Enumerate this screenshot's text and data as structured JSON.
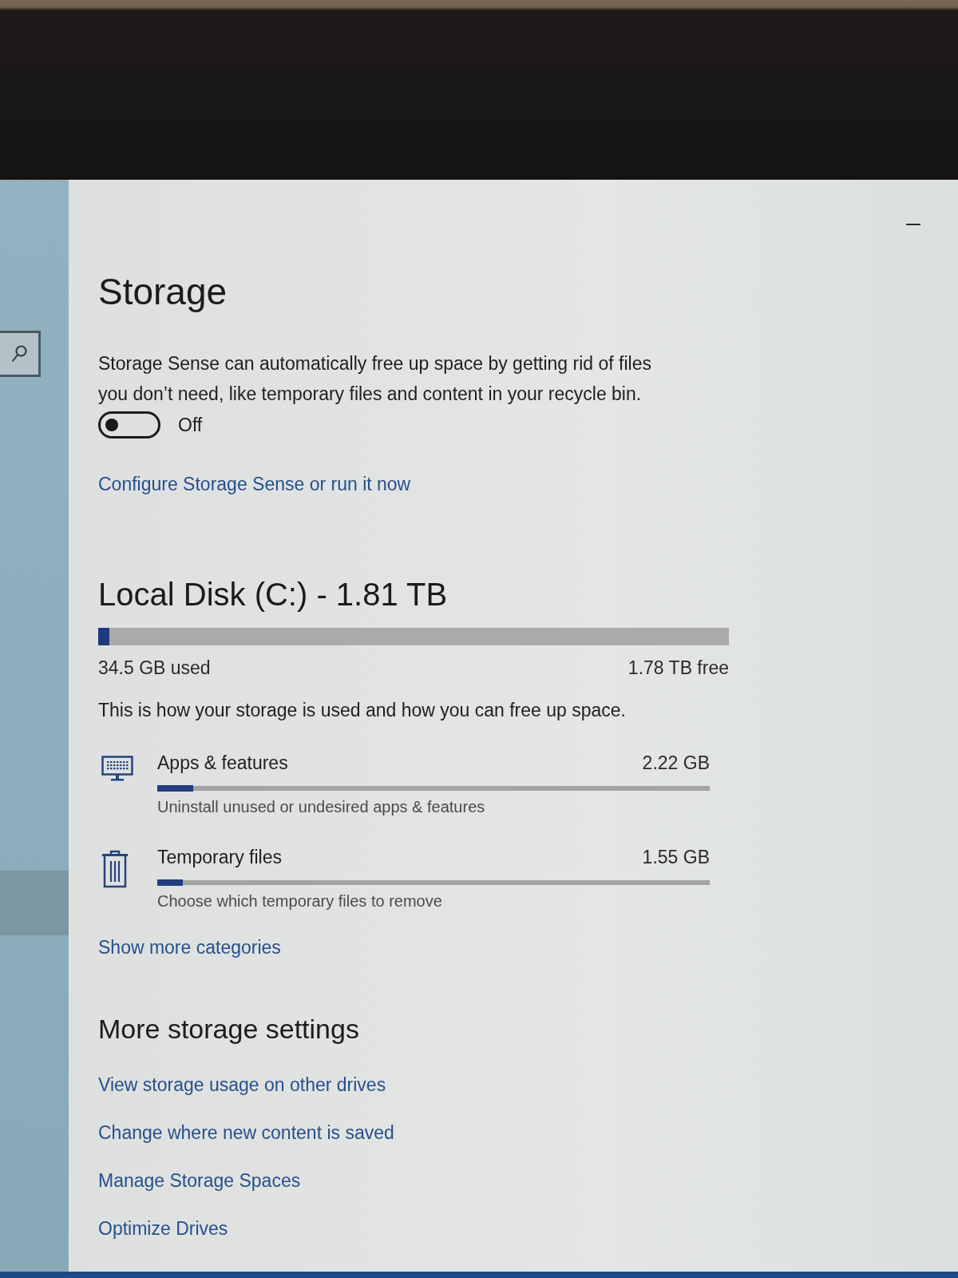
{
  "sidebar": {
    "items": [
      {
        "selected": true
      }
    ]
  },
  "page": {
    "title": "Storage"
  },
  "storage_sense": {
    "description": "Storage Sense can automatically free up space by getting rid of files you don’t need, like temporary files and content in your recycle bin.",
    "toggle": {
      "on": false,
      "label": "Off"
    },
    "link": "Configure Storage Sense or run it now"
  },
  "disk": {
    "title": "Local Disk (C:) - 1.81 TB",
    "level": 0.018,
    "used": "34.5 GB used",
    "free": "1.78 TB free",
    "description": "This is how your storage is used and how you can free up space."
  },
  "categories": [
    {
      "kind": "apps",
      "name": "Apps & features",
      "size": "2.22 GB",
      "level": 0.065,
      "hint": "Uninstall unused or undesired apps & features"
    },
    {
      "kind": "temporary",
      "name": "Temporary files",
      "size": "1.55 GB",
      "level": 0.046,
      "hint": "Choose which temporary files to remove"
    }
  ],
  "show_more_link": "Show more categories",
  "more_settings": {
    "title": "More storage settings",
    "links": [
      "View storage usage on other drives",
      "Change where new content is saved",
      "Manage Storage Spaces",
      "Optimize Drives"
    ]
  }
}
